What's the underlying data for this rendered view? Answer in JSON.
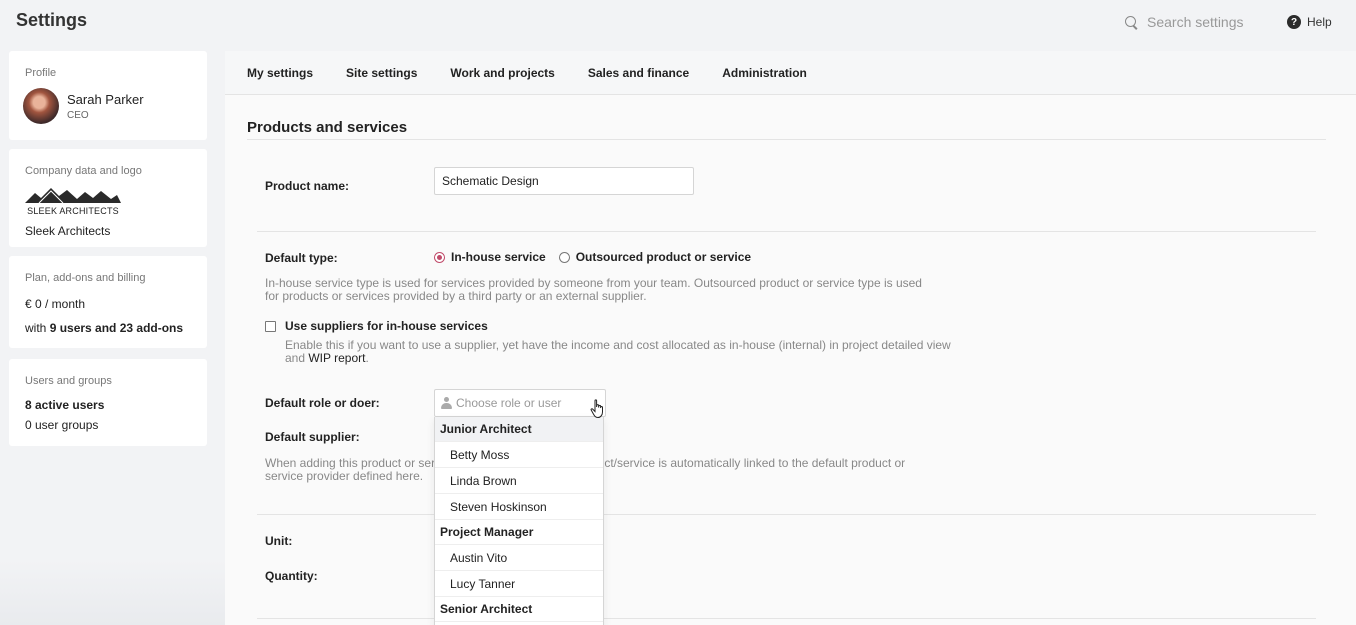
{
  "app": {
    "title": "Settings"
  },
  "search": {
    "placeholder": "Search settings"
  },
  "help": {
    "label": "Help",
    "icon": "help-circle-icon"
  },
  "sidebar": {
    "profile": {
      "title": "Profile",
      "name": "Sarah Parker",
      "role": "CEO"
    },
    "company": {
      "title": "Company data and logo",
      "logo_text": "SLEEK ARCHITECTS",
      "name": "Sleek Architects"
    },
    "billing": {
      "title": "Plan, add-ons and billing",
      "price": "€ 0 / month",
      "users_prefix": "with ",
      "users_bold": "9 users and 23 add-ons"
    },
    "users_groups": {
      "title": "Users and groups",
      "active": "8 active users",
      "groups": "0 user groups"
    }
  },
  "tabs": [
    {
      "label": "My settings"
    },
    {
      "label": "Site settings"
    },
    {
      "label": "Work and projects"
    },
    {
      "label": "Sales and finance"
    },
    {
      "label": "Administration"
    }
  ],
  "form": {
    "section_title": "Products and services",
    "product_name_label": "Product name:",
    "product_name_value": "Schematic Design",
    "default_type_label": "Default type:",
    "type_options": [
      "In-house service",
      "Outsourced product or service"
    ],
    "type_selected": "In-house service",
    "type_help_1": "In-house service type is used for services provided by someone from your team. Outsourced product or service type is used",
    "type_help_2": "for products or services provided by a third party or an external supplier.",
    "use_suppliers_label": "Use suppliers for in-house services",
    "use_suppliers_checked": false,
    "suppliers_help_1": "Enable this if you want to use a supplier, yet have the income and cost allocated as in-house (internal) in project detailed view",
    "suppliers_help_2a": "and ",
    "suppliers_help_link": "WIP report",
    "suppliers_help_2b": ".",
    "default_role_label": "Default role or doer:",
    "role_placeholder": "Choose role or user",
    "default_supplier_label": "Default supplier:",
    "supplier_help_1a": "When adding this product or serv",
    "supplier_help_1b": "luct/service is automatically linked to the default product or",
    "supplier_help_2": "service provider defined here.",
    "unit_label": "Unit:",
    "quantity_label": "Quantity:"
  },
  "dropdown": {
    "groups": [
      {
        "name": "Junior Architect",
        "items": [
          "Betty Moss",
          "Linda Brown",
          "Steven Hoskinson"
        ]
      },
      {
        "name": "Project Manager",
        "items": [
          "Austin Vito",
          "Lucy Tanner"
        ]
      },
      {
        "name": "Senior Architect",
        "items": []
      }
    ]
  },
  "colors": {
    "accent_radio": "#c04b6a",
    "panel_bg": "#fafafa",
    "page_bg": "#f2f3f5"
  }
}
